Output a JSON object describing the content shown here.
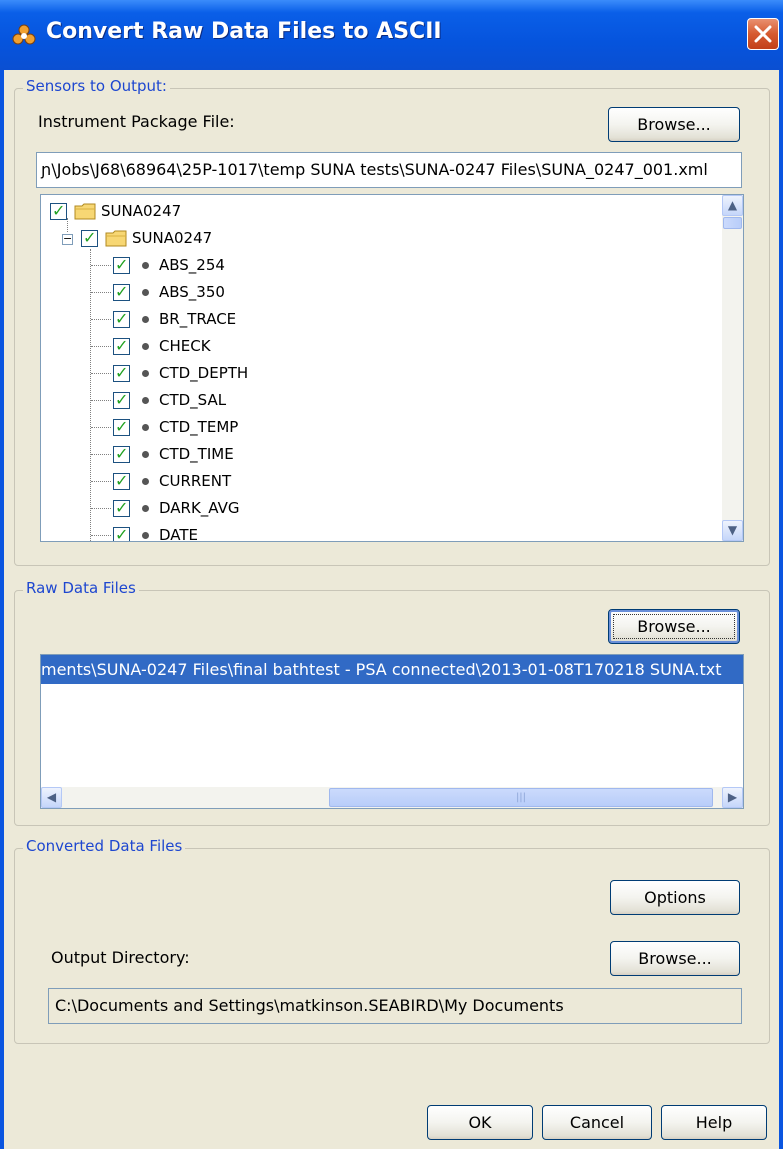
{
  "window": {
    "title": "Convert Raw Data Files to ASCII",
    "app_icon": "biohazard-app-icon",
    "close_icon": "close-x-icon"
  },
  "sensors": {
    "legend": "Sensors to Output:",
    "package_label": "Instrument Package File:",
    "browse_label": "Browse...",
    "package_path": "ɲ\\Jobs\\J68\\68964\\25P-1017\\temp SUNA tests\\SUNA-0247 Files\\SUNA_0247_001.xml",
    "tree": {
      "root": {
        "label": "SUNA0247",
        "checked": true
      },
      "child": {
        "label": "SUNA0247",
        "checked": true,
        "expanded": true
      },
      "items": [
        {
          "label": "ABS_254",
          "checked": true
        },
        {
          "label": "ABS_350",
          "checked": true
        },
        {
          "label": "BR_TRACE",
          "checked": true
        },
        {
          "label": "CHECK",
          "checked": true
        },
        {
          "label": "CTD_DEPTH",
          "checked": true
        },
        {
          "label": "CTD_SAL",
          "checked": true
        },
        {
          "label": "CTD_TEMP",
          "checked": true
        },
        {
          "label": "CTD_TIME",
          "checked": true
        },
        {
          "label": "CURRENT",
          "checked": true
        },
        {
          "label": "DARK_AVG",
          "checked": true
        },
        {
          "label": "DATE",
          "checked": true
        }
      ],
      "expander_symbol": "−"
    }
  },
  "raw": {
    "legend": "Raw Data Files",
    "browse_label": "Browse...",
    "files": [
      "ments\\SUNA-0247 Files\\final bathtest - PSA connected\\2013-01-08T170218 SUNA.txt"
    ],
    "selected_index": 0
  },
  "converted": {
    "legend": "Converted Data Files",
    "options_label": "Options",
    "output_label": "Output Directory:",
    "browse_label": "Browse...",
    "output_path": "C:\\Documents and Settings\\matkinson.SEABIRD\\My Documents"
  },
  "footer": {
    "ok_label": "OK",
    "cancel_label": "Cancel",
    "help_label": "Help"
  },
  "scroll_glyphs": {
    "up": "▲",
    "down": "▼",
    "left": "◀",
    "right": "▶",
    "grip": "|||"
  }
}
